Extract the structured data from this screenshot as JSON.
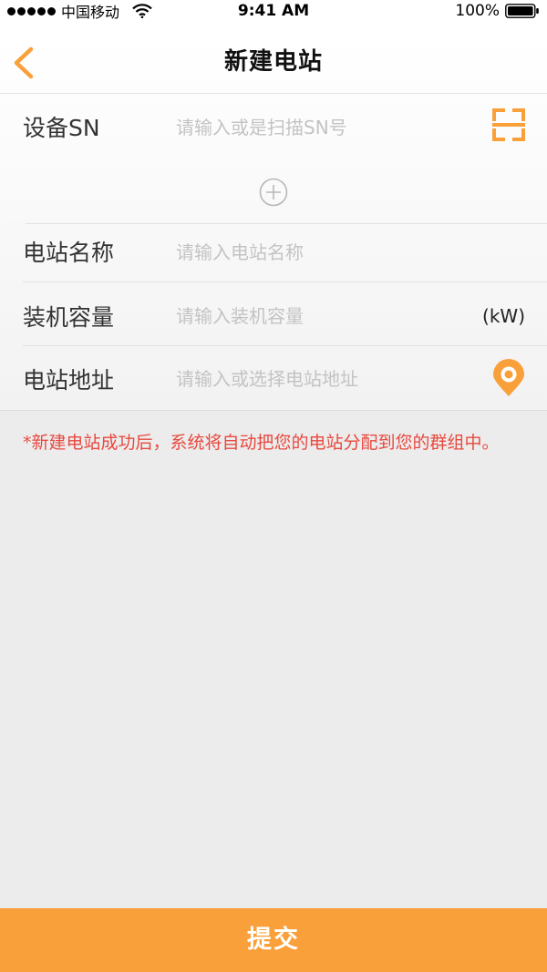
{
  "status_bar": {
    "carrier": "中国移动",
    "time": "9:41 AM",
    "battery": "100%"
  },
  "nav": {
    "title": "新建电站"
  },
  "form": {
    "sn": {
      "label": "设备SN",
      "placeholder": "请输入或是扫描SN号"
    },
    "name": {
      "label": "电站名称",
      "placeholder": "请输入电站名称"
    },
    "capacity": {
      "label": "装机容量",
      "placeholder": "请输入装机容量",
      "unit": "(kW)"
    },
    "address": {
      "label": "电站地址",
      "placeholder": "请输入或选择电站地址"
    }
  },
  "note": "*新建电站成功后，系统将自动把您的电站分配到您的群组中。",
  "submit_label": "提交",
  "colors": {
    "accent": "#f9a03b",
    "note": "#e8493f"
  },
  "icons": [
    "back-chevron-icon",
    "scan-icon",
    "add-circle-icon",
    "location-pin-icon",
    "wifi-icon",
    "battery-icon"
  ]
}
